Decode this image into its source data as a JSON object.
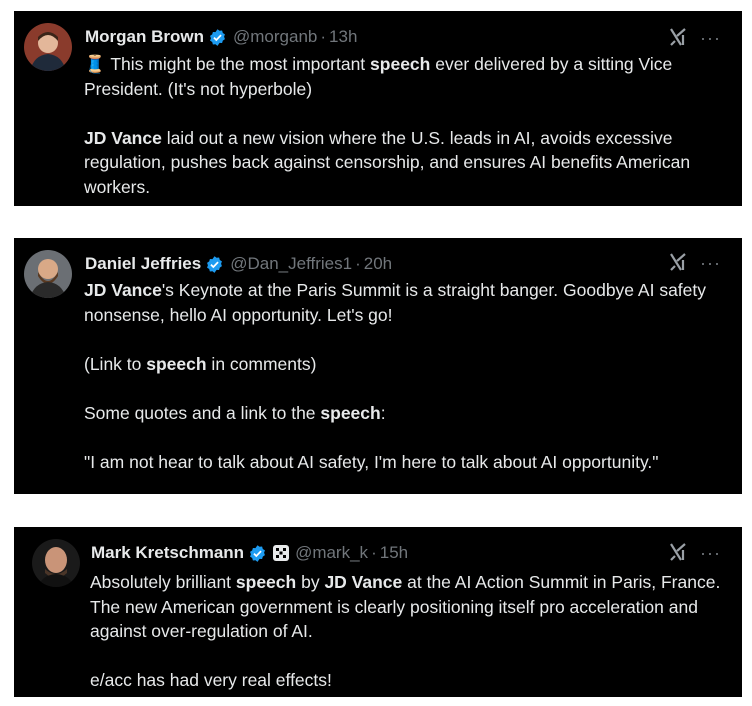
{
  "tweets": [
    {
      "name": "Morgan Brown",
      "handle": "@morganb",
      "time": "13h",
      "line1_emoji": "🧵",
      "t1": {
        "a": " This might be the most important ",
        "b": "speech",
        "c": " ever delivered by a sitting Vice President. (It's not hyperbole)"
      },
      "t2": {
        "a": "JD Vance",
        "b": " laid out a new vision where the U.S. leads in AI, avoids excessive regulation, pushes back against censorship, and ensures AI benefits American workers."
      }
    },
    {
      "name": "Daniel Jeffries",
      "handle": "@Dan_Jeffries1",
      "time": "20h",
      "p1": {
        "a": "JD Vance",
        "b": "'s Keynote at the Paris Summit is a straight banger.  Goodbye AI safety nonsense, hello AI opportunity. Let's go!"
      },
      "p2": {
        "a": "(Link to ",
        "b": "speech",
        "c": " in comments)"
      },
      "p3": {
        "a": "Some quotes and a link to the ",
        "b": "speech",
        "c": ":"
      },
      "p4": "\"I am not hear to talk about AI safety, I'm here to talk about AI opportunity.\""
    },
    {
      "name": "Mark Kretschmann",
      "handle": "@mark_k",
      "time": "15h",
      "p1": {
        "a": "Absolutely brilliant ",
        "b": "speech",
        "c": " by ",
        "d": "JD Vance",
        "e": " at the AI Action Summit in Paris, France. The new American government is clearly positioning itself pro acceleration and against over-regulation of AI."
      },
      "p2": "e/acc has had very real effects!"
    }
  ],
  "separator": "·",
  "more_label": "···",
  "colors": {
    "background": "#000000",
    "text": "#e7e9ea",
    "muted": "#71767b",
    "verified": "#1d9bf0"
  },
  "icons": [
    "verified-badge-icon",
    "grok-icon",
    "more-options-icon",
    "affiliate-badge-icon"
  ]
}
